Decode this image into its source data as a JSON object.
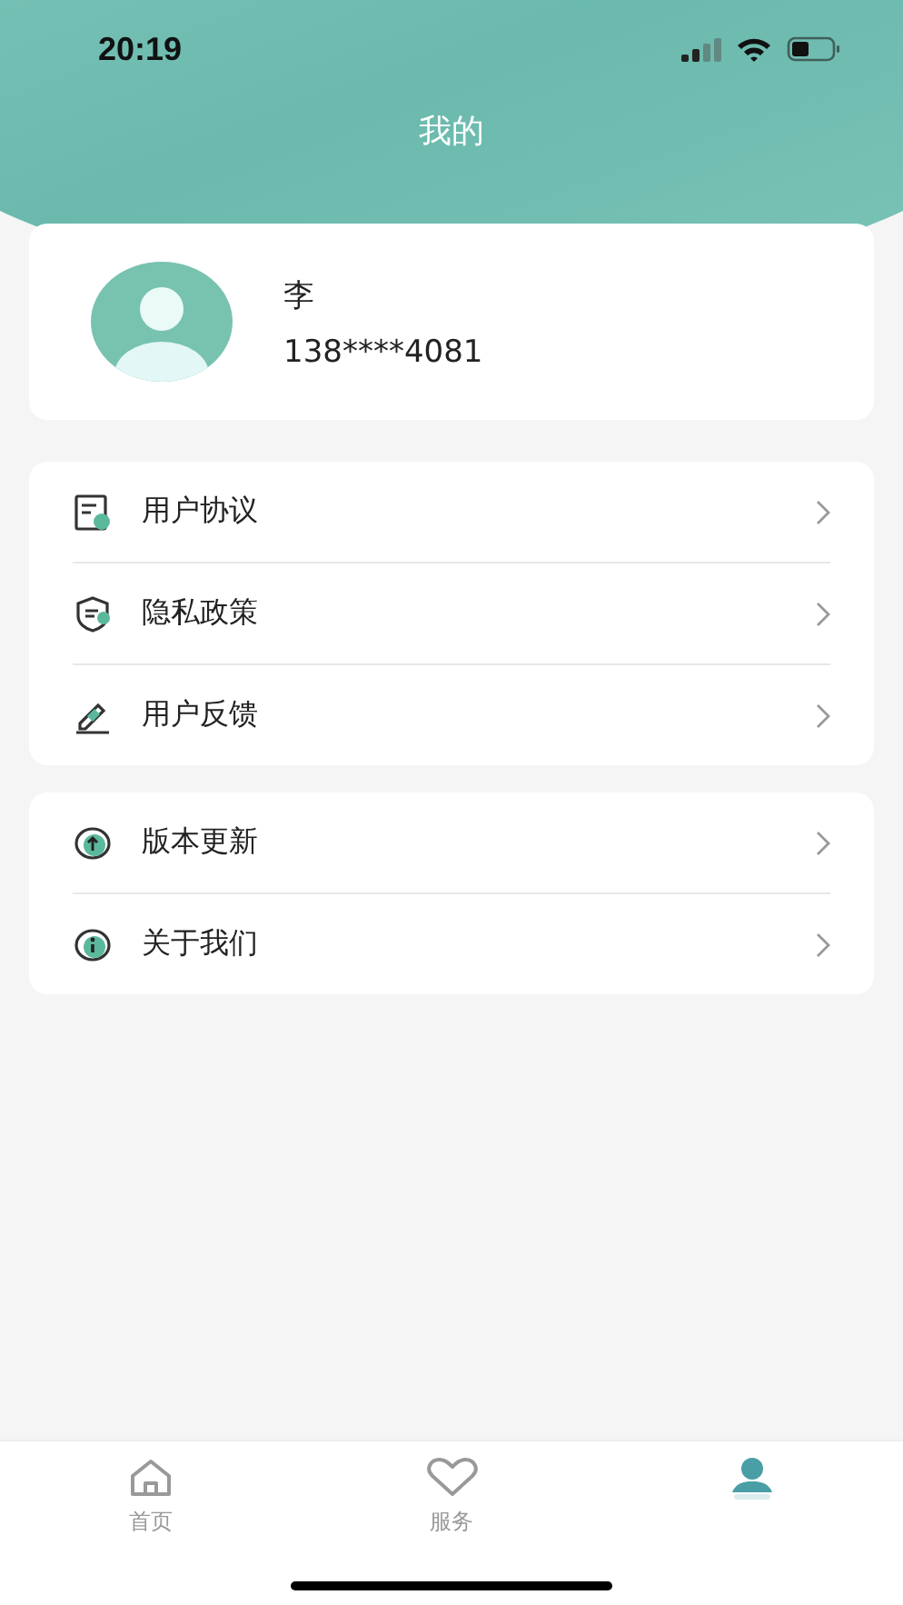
{
  "status_bar": {
    "time": "20:19"
  },
  "header": {
    "title": "我的"
  },
  "profile": {
    "name": "李",
    "phone": "138****4081"
  },
  "menu_groups": [
    {
      "items": [
        {
          "kind": "document",
          "label": "用户协议"
        },
        {
          "kind": "shield",
          "label": "隐私政策"
        },
        {
          "kind": "pencil",
          "label": "用户反馈"
        }
      ]
    },
    {
      "items": [
        {
          "kind": "update",
          "label": "版本更新"
        },
        {
          "kind": "info",
          "label": "关于我们"
        }
      ]
    }
  ],
  "tabs": [
    {
      "kind": "home",
      "label": "首页",
      "selected": false
    },
    {
      "kind": "heart",
      "label": "服务",
      "selected": false
    },
    {
      "kind": "person",
      "selected": true
    }
  ]
}
